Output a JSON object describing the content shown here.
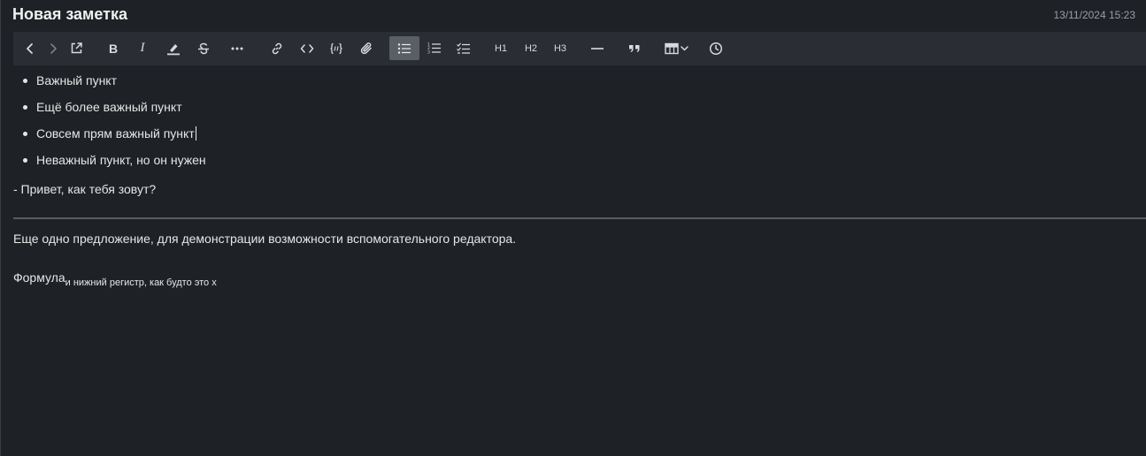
{
  "note": {
    "title": "Новая заметка",
    "timestamp": "13/11/2024 15:23"
  },
  "toolbar": {
    "buttons": [
      {
        "name": "back-button",
        "icon": "chevron-left-icon"
      },
      {
        "name": "forward-button",
        "icon": "chevron-right-icon"
      },
      {
        "name": "open-external-button",
        "icon": "external-link-icon"
      },
      {
        "name": "bold-button",
        "label": "B"
      },
      {
        "name": "italic-button",
        "label": "I"
      },
      {
        "name": "highlight-button",
        "icon": "highlighter-icon"
      },
      {
        "name": "strikethrough-button",
        "icon": "strikethrough-icon"
      },
      {
        "name": "more-button",
        "icon": "ellipsis-icon"
      },
      {
        "name": "link-button",
        "icon": "link-icon"
      },
      {
        "name": "code-button",
        "icon": "code-icon"
      },
      {
        "name": "code-block-button",
        "icon": "code-block-icon"
      },
      {
        "name": "attach-button",
        "icon": "paperclip-icon"
      },
      {
        "name": "bullet-list-button",
        "icon": "bullet-list-icon",
        "active": true
      },
      {
        "name": "numbered-list-button",
        "icon": "numbered-list-icon"
      },
      {
        "name": "checklist-button",
        "icon": "checklist-icon"
      },
      {
        "name": "heading1-button",
        "label": "H1"
      },
      {
        "name": "heading2-button",
        "label": "H2"
      },
      {
        "name": "heading3-button",
        "label": "H3"
      },
      {
        "name": "horizontal-rule-button",
        "icon": "horizontal-rule-icon"
      },
      {
        "name": "quote-button",
        "icon": "quote-icon"
      },
      {
        "name": "table-button",
        "icon": "table-icon"
      },
      {
        "name": "history-button",
        "icon": "clock-icon"
      }
    ]
  },
  "editor": {
    "bullets": [
      "Важный пункт",
      "Ещё более важный пункт",
      "Совсем прям важный пункт",
      "Неважный пункт, но он нужен"
    ],
    "dialogue": "- Привет, как тебя зовут?",
    "sentence": "Еще одно предложение, для демонстрации возможности вспомогательного редактора.",
    "formula_main": "Формула",
    "formula_sub": "и нижний регистр, как будто это х"
  },
  "colors": {
    "background": "#1e2126",
    "toolbar": "#2a2d33",
    "active_button": "#5a5e66",
    "text": "#e6e6e6",
    "timestamp": "#9a9ea5",
    "divider": "#5a5d62"
  }
}
